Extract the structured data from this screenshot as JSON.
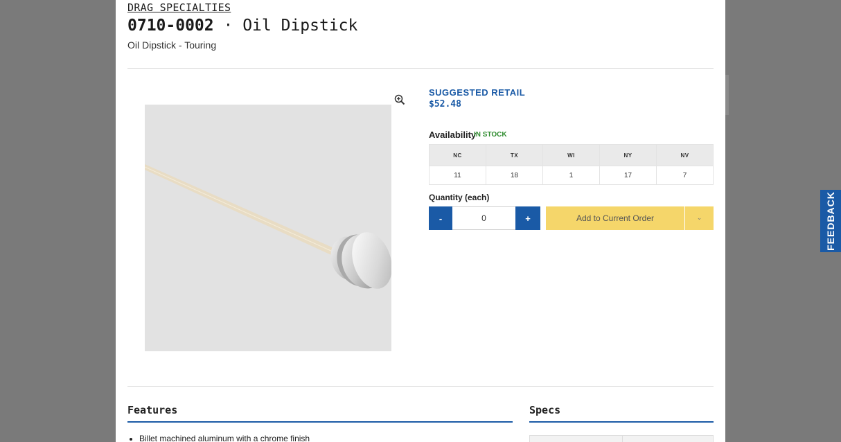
{
  "product": {
    "brand": "DRAG SPECIALTIES",
    "part_number": "0710-0002",
    "separator": "·",
    "name": "Oil Dipstick",
    "subtitle": "Oil Dipstick - Touring"
  },
  "pricing": {
    "label": "SUGGESTED RETAIL",
    "price": "$52.48"
  },
  "availability": {
    "label": "Availability",
    "status": "IN STOCK",
    "warehouses": [
      "NC",
      "TX",
      "WI",
      "NY",
      "NV"
    ],
    "quantities": [
      "11",
      "18",
      "1",
      "17",
      "7"
    ]
  },
  "quantity": {
    "label": "Quantity (each)",
    "minus": "-",
    "plus": "+",
    "value": "0"
  },
  "actions": {
    "add_to_order": "Add to Current Order",
    "dropdown_caret": "⌄"
  },
  "sections": {
    "features_title": "Features",
    "specs_title": "Specs",
    "features": [
      "Billet machined aluminum with a chrome finish"
    ]
  },
  "feedback": "FEEDBACK",
  "icons": {
    "zoom": "zoom-in-icon"
  },
  "colors": {
    "accent": "#1a5aa6",
    "in_stock": "#2e8b2e",
    "add_button": "#f5d66a"
  }
}
